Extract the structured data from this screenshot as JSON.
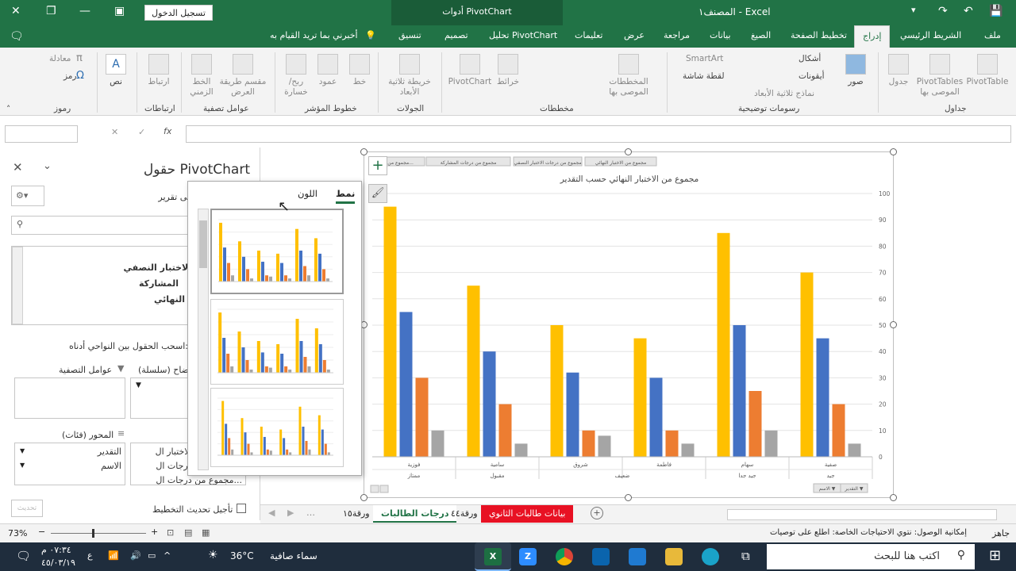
{
  "titlebar": {
    "doc": "المصنف١  -  Excel",
    "context": "أدوات PivotChart",
    "signin": "تسجيل الدخول"
  },
  "tabs": {
    "file": "ملف",
    "home": "الشريط الرئيسي",
    "insert": "إدراج",
    "layout": "تخطيط الصفحة",
    "formulas": "الصيغ",
    "data": "بيانات",
    "review": "مراجعة",
    "view": "عرض",
    "help": "تعليمات",
    "analyze": "تحليل PivotChart",
    "design": "تصميم",
    "format": "تنسيق",
    "tellme": "أخبرني بما تريد القيام به"
  },
  "ribbon": {
    "tables": {
      "pivot": "PivotTable",
      "rec": "PivotTables الموصى بها",
      "table": "جدول",
      "group": "جداول"
    },
    "illus": {
      "pictures": "صور",
      "shapes": "أشكال",
      "icons": "أيقونات",
      "models": "نماذج ثلاثية الأبعاد",
      "smartart": "SmartArt",
      "screenshot": "لقطة شاشة",
      "group": "رسومات توضيحية"
    },
    "charts": {
      "rec": "المخططات الموصى بها",
      "maps": "خرائط",
      "pivotchart": "PivotChart",
      "group": "مخططات"
    },
    "tours": {
      "map3d": "خريطة ثلاثية الأبعاد",
      "group": "الجولات"
    },
    "spark": {
      "line": "خط",
      "column": "عمود",
      "winloss": "ربح/ خسارة",
      "group": "خطوط المؤشر"
    },
    "filters": {
      "slicer": "مقسم طريقة العرض",
      "timeline": "الخط الزمني",
      "group": "عوامل تصفية"
    },
    "links": {
      "link": "ارتباط",
      "group": "ارتباطات"
    },
    "text": {
      "text": "نص"
    },
    "symbols": {
      "equation": "معادلة",
      "symbol": "رمز",
      "group": "رموز"
    }
  },
  "pane": {
    "title": "حقول PivotChart",
    "choose": "حقول لإضافتها إلى تقرير:",
    "fields": [
      "الاختبار النصفي",
      "المشاركة",
      "النهائي"
    ],
    "drag": "اسحب الحقول بين النواحي أدناه:",
    "filters_label": "عوامل التصفية",
    "legend_label": "وسيلة الإيضاح (سلسلة)",
    "axis_label": "المحور (فئات)",
    "axis_items": [
      "التقدير",
      "الاسم"
    ],
    "legend_items": [
      "مجموع من الاختبار ال...",
      "مجموع من درجات ال...",
      "مجموع من درجات ال..."
    ],
    "defer": "تأجيل تحديث التخطيط",
    "update": "تحديث"
  },
  "popup": {
    "style": "نمط",
    "color": "اللون"
  },
  "chart_data": {
    "type": "bar",
    "title": "مجموع من الاختبار النهائي حسب التقدير",
    "field_buttons": [
      "مجموع من الاختبار النهائي",
      "مجموع من درجات الاختبار النصفي",
      "مجموع من درجات المشاركة",
      "مجموع من الح..."
    ],
    "ylim": [
      0,
      100
    ],
    "yticks": [
      0,
      10,
      20,
      30,
      40,
      50,
      60,
      70,
      80,
      90,
      100
    ],
    "categories": [
      "صفية",
      "سهام",
      "فاطمة",
      "شروق",
      "سامية",
      "فوزية"
    ],
    "groups": [
      "جيد",
      "جيد جدا",
      "ضعيف",
      "مقبول",
      "ممتاز"
    ],
    "series": [
      {
        "color": "#a5a5a5",
        "values": [
          5,
          10,
          5,
          8,
          5,
          10
        ]
      },
      {
        "color": "#ed7d31",
        "values": [
          20,
          25,
          10,
          10,
          20,
          30
        ]
      },
      {
        "color": "#4472c4",
        "values": [
          45,
          50,
          30,
          32,
          40,
          55
        ]
      },
      {
        "color": "#ffc000",
        "values": [
          70,
          85,
          45,
          50,
          65,
          95
        ]
      }
    ],
    "axis_buttons": [
      "التقدير",
      "الاسم"
    ]
  },
  "sheets": {
    "tabs": [
      "بيانات طالبات الثانوي",
      "ورقة٤٤",
      "درجات الطالبات",
      "ورقة١٥"
    ]
  },
  "status": {
    "ready": "جاهز",
    "access": "إمكانية الوصول: نتوي الاحتياجات الخاصة: اطلع على توصيات",
    "zoom": "73%"
  },
  "taskbar": {
    "search": "اكتب هنا للبحث",
    "weather": "سماء صافية",
    "temp": "36°C",
    "time": "٠٧:٣٤ م",
    "date": "٤٥/٠٣/١٩"
  }
}
